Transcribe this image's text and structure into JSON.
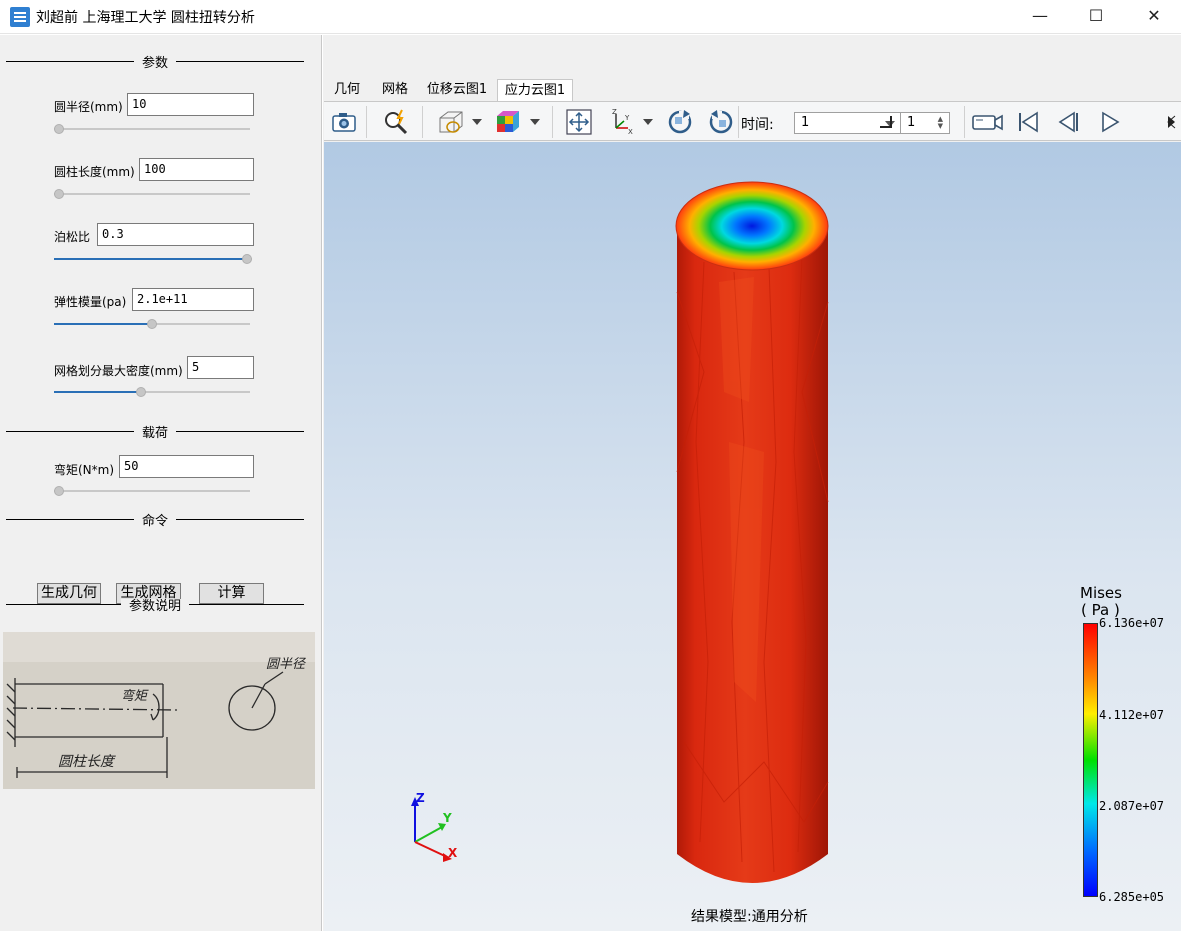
{
  "window": {
    "title": "刘超前 上海理工大学 圆柱扭转分析",
    "minimize": "—",
    "maximize": "☐",
    "close": "✕"
  },
  "params": {
    "heading": "参数",
    "radius": {
      "label": "圆半径(mm)",
      "value": "10",
      "slider_fraction": 0.0
    },
    "length": {
      "label": "圆柱长度(mm)",
      "value": "100",
      "slider_fraction": 0.0
    },
    "poisson": {
      "label": "泊松比",
      "value": "0.3",
      "slider_fraction": 1.0
    },
    "modulus": {
      "label": "弹性模量(pa)",
      "value": "2.1e+11",
      "slider_fraction": 0.5
    },
    "mesh": {
      "label": "网格划分最大密度(mm)",
      "value": "5",
      "slider_fraction": 0.44
    }
  },
  "load": {
    "heading": "载荷",
    "torque": {
      "label": "弯矩(N*m)",
      "value": "50",
      "slider_fraction": 0.0
    }
  },
  "commands": {
    "heading": "命令",
    "gen_geometry": "生成几何",
    "gen_mesh": "生成网格",
    "compute": "计算"
  },
  "description": {
    "heading": "参数说明",
    "sketch_labels": {
      "torque": "弯矩",
      "length": "圆柱长度",
      "radius": "圆半径"
    }
  },
  "tabs": [
    {
      "label": "几何"
    },
    {
      "label": "网格"
    },
    {
      "label": "位移云图1"
    },
    {
      "label": "应力云图1",
      "active": true
    }
  ],
  "toolbar": {
    "time_label": "时间:",
    "time_value": "1",
    "step_value": "1"
  },
  "legend": {
    "title": "Mises",
    "unit": "( Pa )",
    "values": [
      "6.136e+07",
      "4.112e+07",
      "2.087e+07",
      "6.285e+05"
    ],
    "colors": [
      "#ff0000",
      "#00e000",
      "#00e8e8",
      "#0000ff"
    ]
  },
  "axes": {
    "x": "X",
    "y": "Y",
    "z": "Z"
  },
  "model_caption": "结果模型:通用分析"
}
